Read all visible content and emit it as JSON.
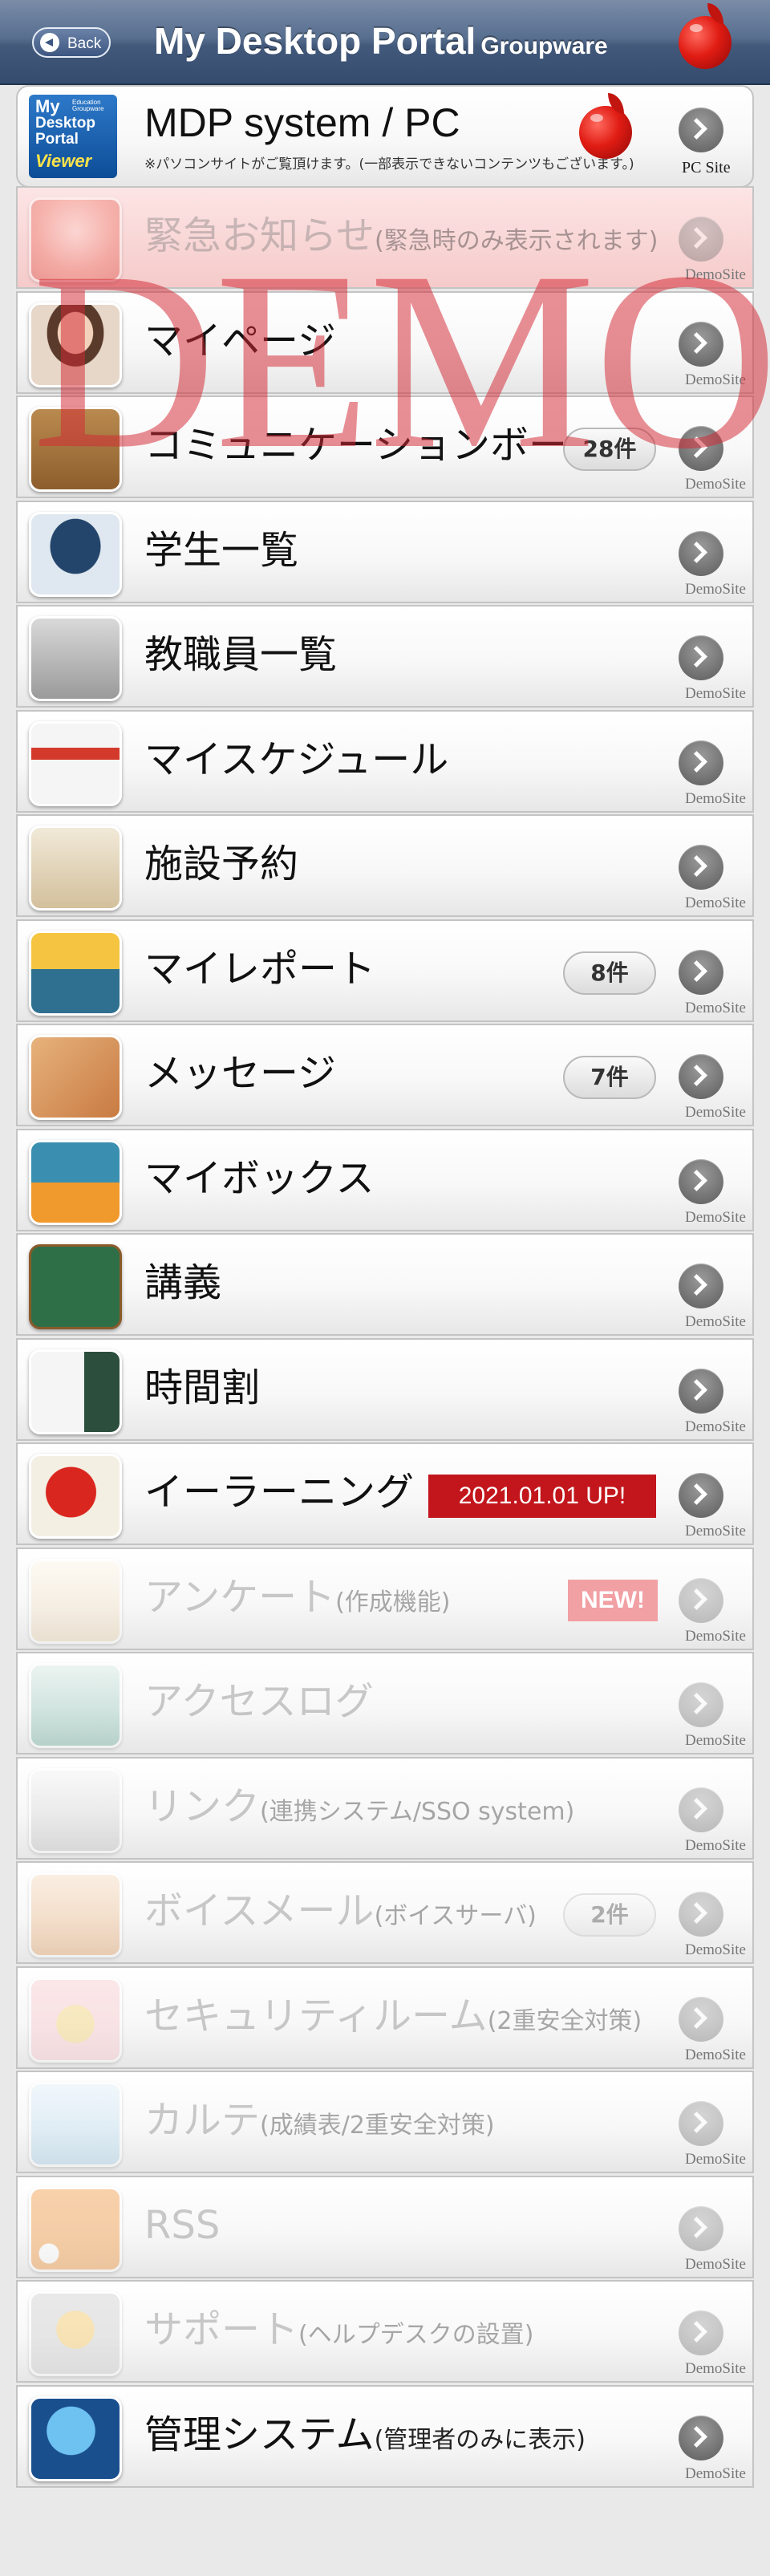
{
  "header": {
    "back_label": "Back",
    "title": "My Desktop Portal",
    "title_suffix": "Groupware"
  },
  "mdp": {
    "logo_lines": [
      "My",
      "Desktop",
      "Portal",
      "Viewer"
    ],
    "logo_small": "Education Groupware",
    "title": "MDP system / PC",
    "subtitle": "※パソコンサイトがご覧頂けます。(一部表示できないコンテンツもございます。)",
    "pc_label": "PC Site"
  },
  "watermark": "DEMO",
  "site_label": "DemoSite",
  "rows": [
    {
      "label": "緊急お知らせ",
      "sub": "(緊急時のみ表示されます)",
      "icon": "emergency-icon",
      "disabled": true,
      "alert": true
    },
    {
      "label": "マイページ",
      "sub": "",
      "icon": "profile-photo-icon",
      "disabled": false
    },
    {
      "label": "コミュニケーションボード",
      "sub": "",
      "icon": "board-icon",
      "disabled": false,
      "badge": "28件"
    },
    {
      "label": "学生一覧",
      "sub": "",
      "icon": "graduation-cap-icon",
      "disabled": false
    },
    {
      "label": "教職員一覧",
      "sub": "",
      "icon": "building-icon",
      "disabled": false
    },
    {
      "label": "マイスケジュール",
      "sub": "",
      "icon": "calendar-icon",
      "disabled": false
    },
    {
      "label": "施設予約",
      "sub": "",
      "icon": "facility-icon",
      "disabled": false
    },
    {
      "label": "マイレポート",
      "sub": "",
      "icon": "report-tray-icon",
      "disabled": false,
      "badge": "8件"
    },
    {
      "label": "メッセージ",
      "sub": "",
      "icon": "envelope-icon",
      "disabled": false,
      "badge": "7件"
    },
    {
      "label": "マイボックス",
      "sub": "",
      "icon": "box-icon",
      "disabled": false
    },
    {
      "label": "講義",
      "sub": "",
      "icon": "blackboard-icon",
      "disabled": false
    },
    {
      "label": "時間割",
      "sub": "",
      "icon": "timetable-icon",
      "disabled": false
    },
    {
      "label": "イーラーニング",
      "sub": "",
      "icon": "elearning-icon",
      "disabled": false,
      "update": "2021.01.01 UP!"
    },
    {
      "label": "アンケート",
      "sub": "(作成機能)",
      "icon": "survey-icon",
      "disabled": true,
      "new": "NEW!"
    },
    {
      "label": "アクセスログ",
      "sub": "",
      "icon": "chart-icon",
      "disabled": true
    },
    {
      "label": "リンク",
      "sub": "(連携システム/SSO system)",
      "icon": "link-icon",
      "disabled": true
    },
    {
      "label": "ボイスメール",
      "sub": "(ボイスサーバ)",
      "icon": "voice-mail-icon",
      "disabled": true,
      "badge": "2件"
    },
    {
      "label": "セキュリティルーム",
      "sub": "(2重安全対策)",
      "icon": "lock-icon",
      "disabled": true
    },
    {
      "label": "カルテ",
      "sub": "(成績表/2重安全対策)",
      "icon": "chart-document-icon",
      "disabled": true
    },
    {
      "label": "RSS",
      "sub": "",
      "icon": "rss-icon",
      "disabled": true
    },
    {
      "label": "サポート",
      "sub": "(ヘルプデスクの設置)",
      "icon": "support-headset-icon",
      "disabled": true
    },
    {
      "label": "管理システム",
      "sub": "(管理者のみに表示)",
      "icon": "mdp-globe-icon",
      "disabled": false
    }
  ]
}
